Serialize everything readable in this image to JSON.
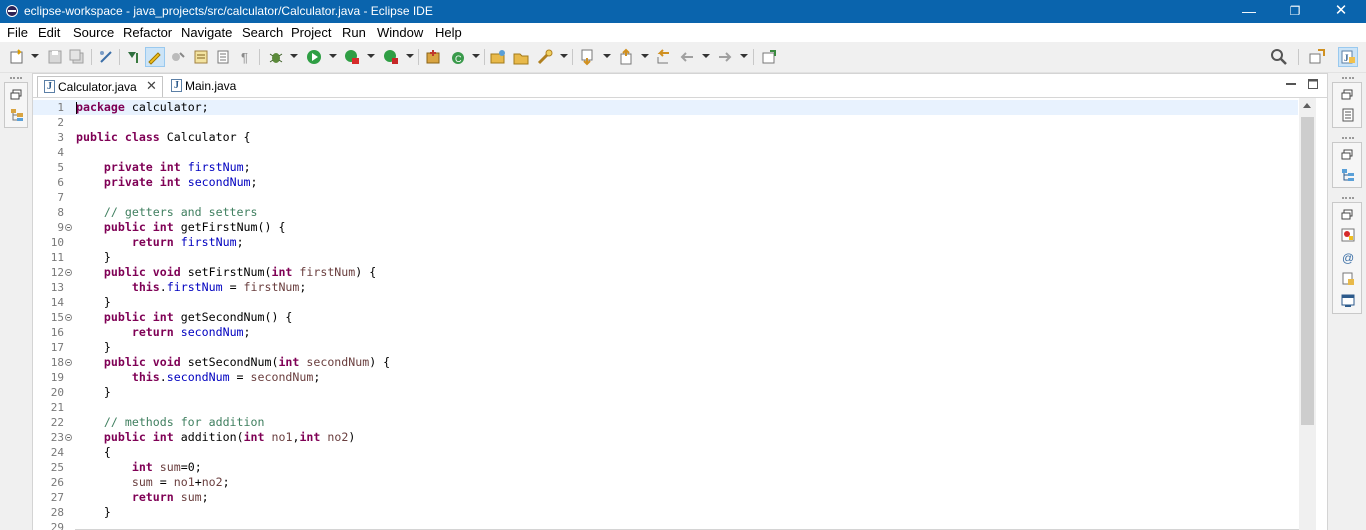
{
  "window": {
    "title": "eclipse-workspace - java_projects/src/calculator/Calculator.java - Eclipse IDE",
    "min_glyph": "—",
    "max_glyph": "❐",
    "close_glyph": "✕"
  },
  "menu": [
    "File",
    "Edit",
    "Source",
    "Refactor",
    "Navigate",
    "Search",
    "Project",
    "Run",
    "Window",
    "Help"
  ],
  "tabs": [
    {
      "label": "Calculator.java",
      "icon": "java-file-icon",
      "active": true,
      "close": "✕"
    },
    {
      "label": "Main.java",
      "icon": "java-file-icon",
      "active": false
    }
  ],
  "code_lines": [
    {
      "n": "1",
      "html": "<span class=\"caret\"></span><span class=\"k\">package</span> calculator;"
    },
    {
      "n": "2",
      "html": ""
    },
    {
      "n": "3",
      "html": "<span class=\"k\">public</span> <span class=\"k\">class</span> Calculator {"
    },
    {
      "n": "4",
      "html": ""
    },
    {
      "n": "5",
      "html": "    <span class=\"k\">private</span> <span class=\"k\">int</span> <span class=\"f\">firstNum</span>;"
    },
    {
      "n": "6",
      "html": "    <span class=\"k\">private</span> <span class=\"k\">int</span> <span class=\"f\">secondNum</span>;"
    },
    {
      "n": "7",
      "html": ""
    },
    {
      "n": "8",
      "html": "    <span class=\"c\">// getters and setters</span>"
    },
    {
      "n": "9",
      "fold": true,
      "html": "    <span class=\"k\">public</span> <span class=\"k\">int</span> getFirstNum() {"
    },
    {
      "n": "10",
      "html": "        <span class=\"k\">return</span> <span class=\"f\">firstNum</span>;"
    },
    {
      "n": "11",
      "html": "    }"
    },
    {
      "n": "12",
      "fold": true,
      "html": "    <span class=\"k\">public</span> <span class=\"k\">void</span> setFirstNum(<span class=\"k\">int</span> <span class=\"p\">firstNum</span>) {"
    },
    {
      "n": "13",
      "html": "        <span class=\"k\">this</span>.<span class=\"f\">firstNum</span> = <span class=\"p\">firstNum</span>;"
    },
    {
      "n": "14",
      "html": "    }"
    },
    {
      "n": "15",
      "fold": true,
      "html": "    <span class=\"k\">public</span> <span class=\"k\">int</span> getSecondNum() {"
    },
    {
      "n": "16",
      "html": "        <span class=\"k\">return</span> <span class=\"f\">secondNum</span>;"
    },
    {
      "n": "17",
      "html": "    }"
    },
    {
      "n": "18",
      "fold": true,
      "html": "    <span class=\"k\">public</span> <span class=\"k\">void</span> setSecondNum(<span class=\"k\">int</span> <span class=\"p\">secondNum</span>) {"
    },
    {
      "n": "19",
      "html": "        <span class=\"k\">this</span>.<span class=\"f\">secondNum</span> = <span class=\"p\">secondNum</span>;"
    },
    {
      "n": "20",
      "html": "    }"
    },
    {
      "n": "21",
      "html": ""
    },
    {
      "n": "22",
      "html": "    <span class=\"c\">// methods for addition</span>"
    },
    {
      "n": "23",
      "fold": true,
      "html": "    <span class=\"k\">public</span> <span class=\"k\">int</span> addition(<span class=\"k\">int</span> <span class=\"p\">no1</span>,<span class=\"k\">int</span> <span class=\"p\">no2</span>)"
    },
    {
      "n": "24",
      "html": "    {"
    },
    {
      "n": "25",
      "html": "        <span class=\"k\">int</span> <span class=\"p\">sum</span>=0;"
    },
    {
      "n": "26",
      "html": "        <span class=\"p\">sum</span> = <span class=\"p\">no1</span>+<span class=\"p\">no2</span>;"
    },
    {
      "n": "27",
      "html": "        <span class=\"k\">return</span> <span class=\"p\">sum</span>;"
    },
    {
      "n": "28",
      "html": "    }"
    },
    {
      "n": "29",
      "html": ""
    }
  ],
  "colors": {
    "titlebar": "#0a64ad",
    "keyword": "#7f0055",
    "field": "#0000c0",
    "param": "#6a3e3e",
    "comment": "#3f7f5f",
    "current_line": "#e8f2fe"
  }
}
